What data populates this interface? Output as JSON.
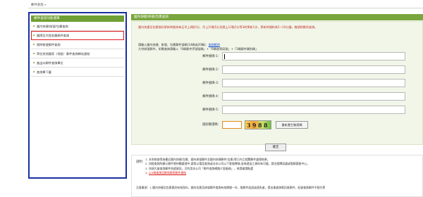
{
  "breadcrumb": "郵件查詢 »",
  "sidebar": {
    "title": "郵件查詢功能選單",
    "items": [
      {
        "label": "國內快捷/掛號/包裹查詢"
      },
      {
        "label": "國際及大陸各類郵件查詢"
      },
      {
        "label": "限時掛號郵件查詢"
      },
      {
        "label": "寄往其他國家（地區）郵件查詢網站連結"
      },
      {
        "label": "進出口郵件查詢單位"
      },
      {
        "label": "查詢單下載"
      }
    ],
    "active_index": 1
  },
  "main": {
    "title": "國內快捷/掛號/包裹查詢",
    "notice": "國內快捷及包裹資料更新時間為每日早上8點5分、早上10點5分及晚上12點5分等3時更新1次，更新時間約為5~10分鐘，敬請稍晚再查詢。",
    "hint_prefix": "請輸入國內快捷、掛號、包裹郵件號碼(14碼或20碼)",
    "hint_link": "查詢範例",
    "hint_line2": "大宗掛號郵件，如需查詢請輸入「6碼郵件序號號碼」+「6碼收寄局號」+「2碼郵件類別碼」",
    "fields": [
      {
        "label": "郵件號碼-1："
      },
      {
        "label": "郵件號碼-2："
      },
      {
        "label": "郵件號碼-3："
      },
      {
        "label": "郵件號碼-4："
      },
      {
        "label": "郵件號碼-5："
      }
    ],
    "captcha_label": "圖形驗證碼：",
    "captcha_code": "3988",
    "regen_button": "重新產生驗證碼",
    "confirm_button": "確定"
  },
  "description": {
    "title": "說明：",
    "items": [
      "本系統查得為最近國內快捷/包裹、國內掛號郵件及國內快捷郵件(包裹)等日內之相關郵件處理結果。",
      "如經查詢所顯示郵件需持續處理中,請再以電話查詢或洽本公司以下客服專線,若係遞送之資料有可疑，請洽相關局處或電郵客服中心。",
      "如須大量查詢郵件投遞資訊，可利用本公司「郵件查詢網路介面服務」，申請書請點選",
      "以3碼查詢回郵袋郵寄郵件連結"
    ],
    "note": "注意事項：1.國內快捷及包裹資訊有效保存，國內包裹及掛號郵件查詢有效期間一年，惟郵件延誤或遺失者，提出後查詢需回收郵件，紀錄查詢郵件不經付費"
  }
}
